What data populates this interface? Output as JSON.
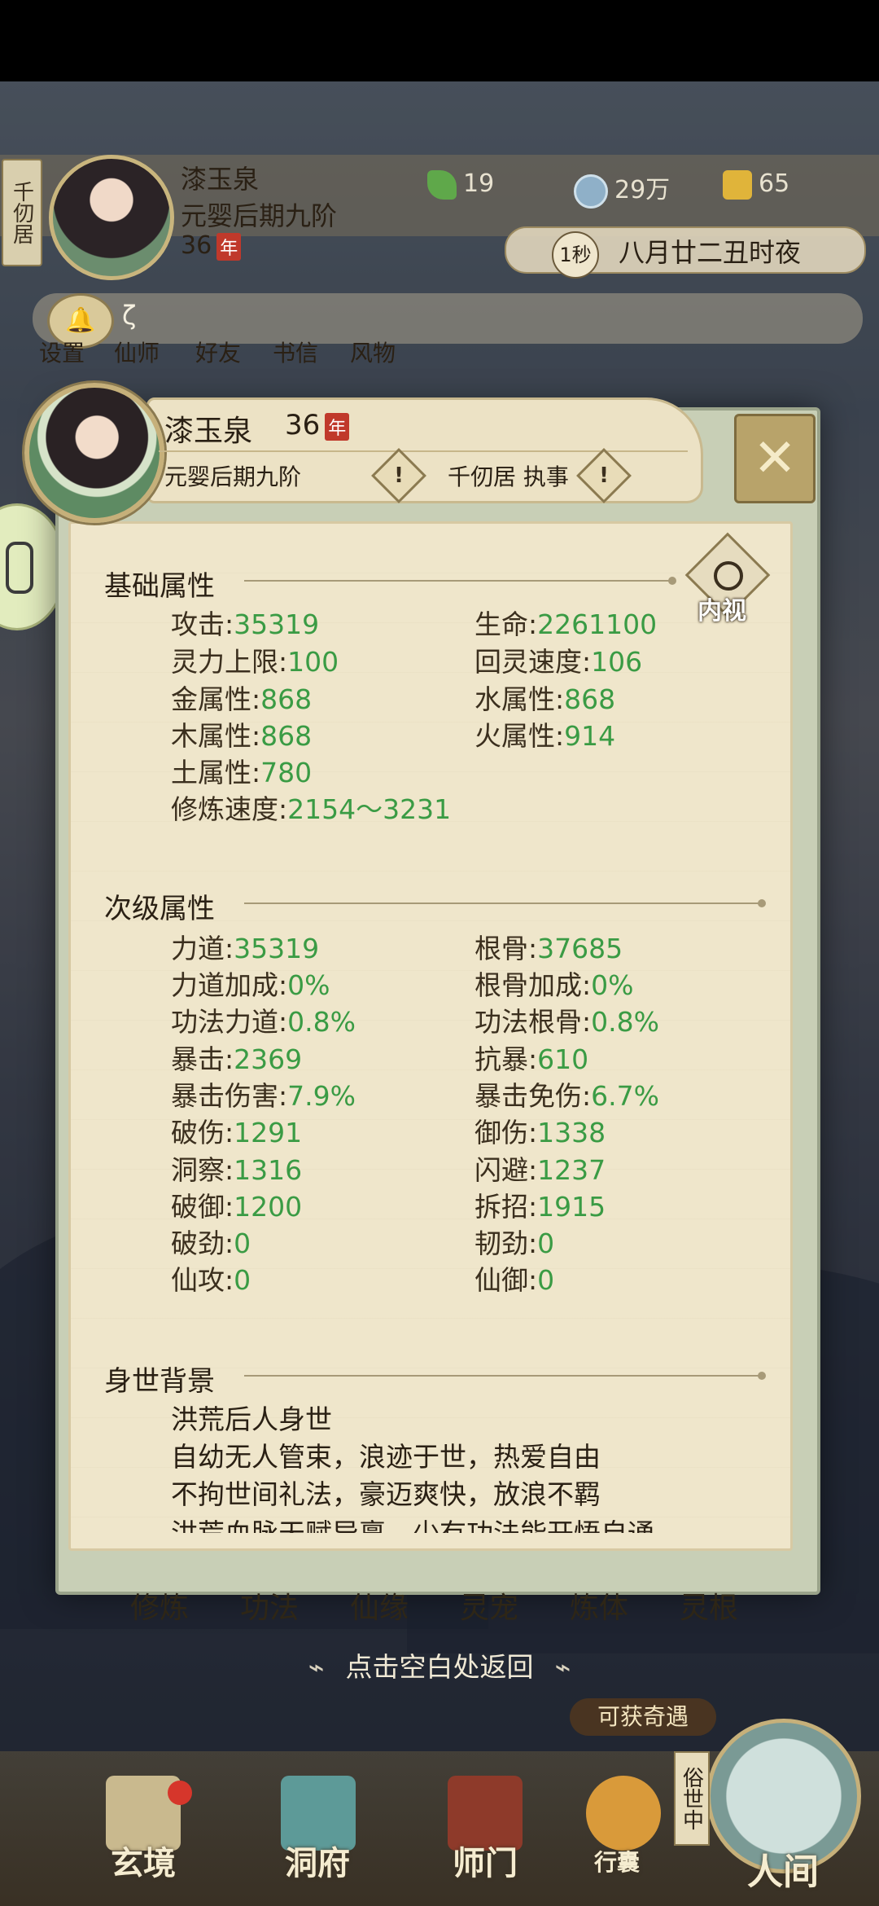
{
  "hud": {
    "location_tag": "千仞居",
    "name": "漆玉泉",
    "realm": "元婴后期九阶",
    "age": "36",
    "age_unit": "年",
    "resources": [
      {
        "icon": "leaf-icon",
        "value": "19",
        "color": "#5fa84a"
      },
      {
        "icon": "coin-icon",
        "value": "29万",
        "color": "#8fb0c8"
      },
      {
        "icon": "gold-ingot-icon",
        "value": "65",
        "color": "#e0b43a"
      }
    ],
    "time_speed": "1秒",
    "date_text": "八月廿二丑时夜",
    "notice_text": "ζ",
    "nav_under": [
      "设置",
      "仙师",
      "好友",
      "书信",
      "风物"
    ]
  },
  "card": {
    "name": "漆玉泉",
    "age": "36",
    "age_unit": "年",
    "realm": "元婴后期九阶",
    "sect": "千仞居 执事"
  },
  "neishi_label": "内视",
  "basic": {
    "title": "基础属性",
    "stats": [
      {
        "label": "攻击:",
        "value": "35319"
      },
      {
        "label": "生命:",
        "value": "2261100"
      },
      {
        "label": "灵力上限:",
        "value": "100"
      },
      {
        "label": "回灵速度:",
        "value": "106"
      },
      {
        "label": "金属性:",
        "value": "868"
      },
      {
        "label": "水属性:",
        "value": "868"
      },
      {
        "label": "木属性:",
        "value": "868"
      },
      {
        "label": "火属性:",
        "value": "914"
      },
      {
        "label": "土属性:",
        "value": "780"
      },
      {
        "label": "",
        "value": ""
      },
      {
        "label": "修炼速度:",
        "value": "2154～3231"
      }
    ]
  },
  "secondary": {
    "title": "次级属性",
    "stats": [
      {
        "label": "力道:",
        "value": "35319"
      },
      {
        "label": "根骨:",
        "value": "37685"
      },
      {
        "label": "力道加成:",
        "value": "0%"
      },
      {
        "label": "根骨加成:",
        "value": "0%"
      },
      {
        "label": "功法力道:",
        "value": "0.8%"
      },
      {
        "label": "功法根骨:",
        "value": "0.8%"
      },
      {
        "label": "暴击:",
        "value": "2369"
      },
      {
        "label": "抗暴:",
        "value": "610"
      },
      {
        "label": "暴击伤害:",
        "value": "7.9%"
      },
      {
        "label": "暴击免伤:",
        "value": "6.7%"
      },
      {
        "label": "破伤:",
        "value": "1291"
      },
      {
        "label": "御伤:",
        "value": "1338"
      },
      {
        "label": "洞察:",
        "value": "1316"
      },
      {
        "label": "闪避:",
        "value": "1237"
      },
      {
        "label": "破御:",
        "value": "1200"
      },
      {
        "label": "拆招:",
        "value": "1915"
      },
      {
        "label": "破劲:",
        "value": "0"
      },
      {
        "label": "韧劲:",
        "value": "0"
      },
      {
        "label": "仙攻:",
        "value": "0"
      },
      {
        "label": "仙御:",
        "value": "0"
      }
    ]
  },
  "background": {
    "title": "身世背景",
    "lines": [
      "洪荒后人身世",
      "自幼无人管束，浪迹于世，热爱自由",
      "不拘世间礼法，豪迈爽快，放浪不羁",
      "洪荒血脉天赋异禀，少有功法能开悟自通"
    ]
  },
  "bottom_tabs": [
    "修炼",
    "功法",
    "仙缘",
    "灵宠",
    "炼体",
    "灵根"
  ],
  "hint": "点击空白处返回",
  "qiyu_button": "可获奇遇",
  "suishi_label": "俗世中",
  "bottom_nav": [
    "玄境",
    "洞府",
    "师门",
    "行囊",
    "人间"
  ]
}
